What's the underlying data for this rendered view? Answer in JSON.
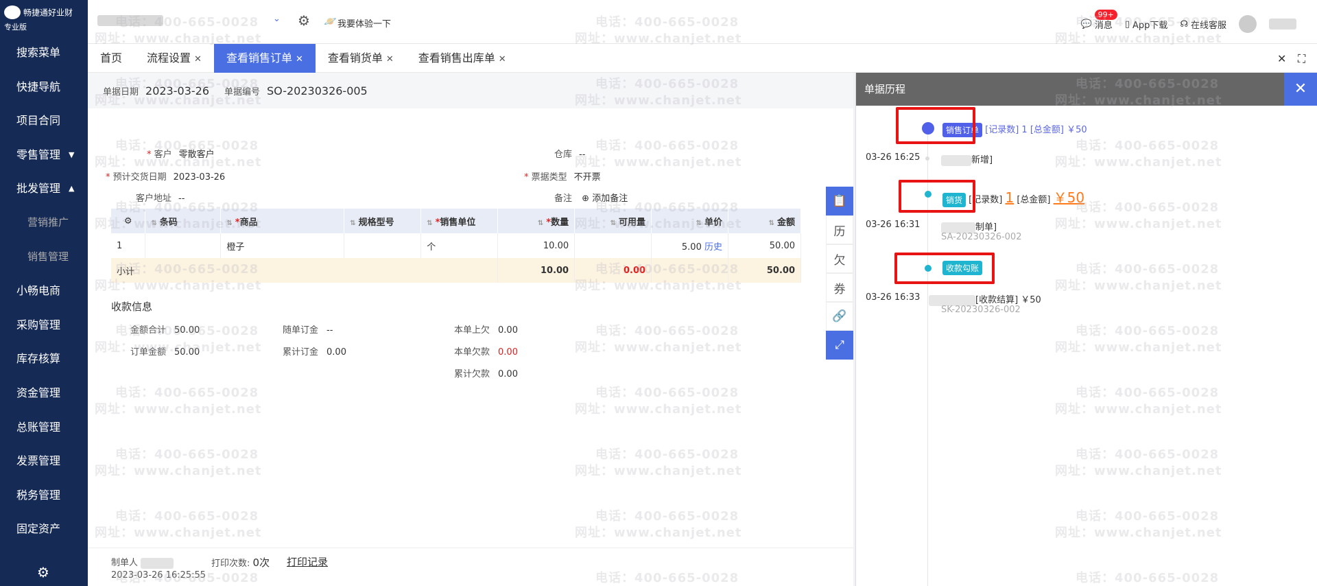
{
  "app": {
    "brand": "畅捷通好业财",
    "edition": "专业版"
  },
  "sidebar": {
    "items": [
      {
        "label": "搜索菜单"
      },
      {
        "label": "快捷导航"
      },
      {
        "label": "项目合同"
      },
      {
        "label": "零售管理",
        "caret": "▼"
      },
      {
        "label": "批发管理",
        "caret": "▲"
      },
      {
        "label": "营销推广"
      },
      {
        "label": "销售管理"
      },
      {
        "label": "小畅电商"
      },
      {
        "label": "采购管理"
      },
      {
        "label": "库存核算"
      },
      {
        "label": "资金管理"
      },
      {
        "label": "总账管理"
      },
      {
        "label": "发票管理"
      },
      {
        "label": "税务管理"
      },
      {
        "label": "固定资产"
      }
    ]
  },
  "topbar": {
    "try_label": "我要体验一下",
    "messages_label": "消息",
    "messages_badge": "99+",
    "app_download": "App下载",
    "online_service": "在线客服"
  },
  "tabs": [
    {
      "label": "首页",
      "closable": false
    },
    {
      "label": "流程设置",
      "closable": true
    },
    {
      "label": "查看销售订单",
      "closable": true,
      "active": true
    },
    {
      "label": "查看销货单",
      "closable": true
    },
    {
      "label": "查看销售出库单",
      "closable": true
    }
  ],
  "doc": {
    "date_label": "单据日期",
    "date_value": "2023-03-26",
    "number_label": "单据编号",
    "number_value": "SO-20230326-005",
    "customer_label": "客户",
    "customer_value": "零散客户",
    "delivery_label": "预计交货日期",
    "delivery_value": "2023-03-26",
    "address_label": "客户地址",
    "address_value": "--",
    "warehouse_label": "仓库",
    "warehouse_value": "--",
    "invoice_label": "票据类型",
    "invoice_value": "不开票",
    "remark_label": "备注",
    "remark_add": "添加备注"
  },
  "table": {
    "headers": [
      "条码",
      "商品",
      "规格型号",
      "销售单位",
      "数量",
      "可用量",
      "单价",
      "金额"
    ],
    "rows": [
      {
        "no": "1",
        "barcode": "",
        "product": "橙子",
        "spec": "",
        "unit": "个",
        "qty": "10.00",
        "avail": "",
        "price": "5.00",
        "history": "历史",
        "amount": "50.00"
      }
    ],
    "subtotal": {
      "label": "小计",
      "qty": "10.00",
      "avail": "0.00",
      "amount": "50.00"
    }
  },
  "payment": {
    "title": "收款信息",
    "total_label": "金额合计",
    "total_value": "50.00",
    "order_amount_label": "订单金额",
    "order_amount_value": "50.00",
    "deposit_label": "随单订金",
    "deposit_value": "--",
    "cum_deposit_label": "累计订金",
    "cum_deposit_value": "0.00",
    "prev_owe_label": "本单上欠",
    "prev_owe_value": "0.00",
    "owe_label": "本单欠款",
    "owe_value": "0.00",
    "cum_owe_label": "累计欠款",
    "cum_owe_value": "0.00"
  },
  "footer": {
    "maker_label": "制单人",
    "made_time": "2023-03-26 16:25:55",
    "print_count_label": "打印次数:",
    "print_count_value": "0次",
    "print_record": "打印记录"
  },
  "history": {
    "title": "单据历程",
    "events": [
      {
        "tag": "销售订单",
        "meta": "[记录数] 1   [总金额] ￥50",
        "time": "03-26 16:25",
        "desc": "新增]"
      },
      {
        "tag": "销货",
        "count_label": "[记录数]",
        "count": "1",
        "amount_label": "[总金额]",
        "amount": "￥50",
        "time": "03-26 16:31",
        "desc": "制单]",
        "code": "SA-20230326-002"
      },
      {
        "tag": "收款勾账",
        "time": "03-26 16:33",
        "desc": "[收款结算] ￥50",
        "code": "SK-20230326-002"
      }
    ]
  },
  "watermark": {
    "phone": "电话：400-665-0028",
    "site": "网址：www.chanjet.net"
  },
  "colors": {
    "sidebar": "#152a55",
    "accent": "#4a6fe3",
    "highlight": "#e81313",
    "orange": "#ff7a1a"
  }
}
